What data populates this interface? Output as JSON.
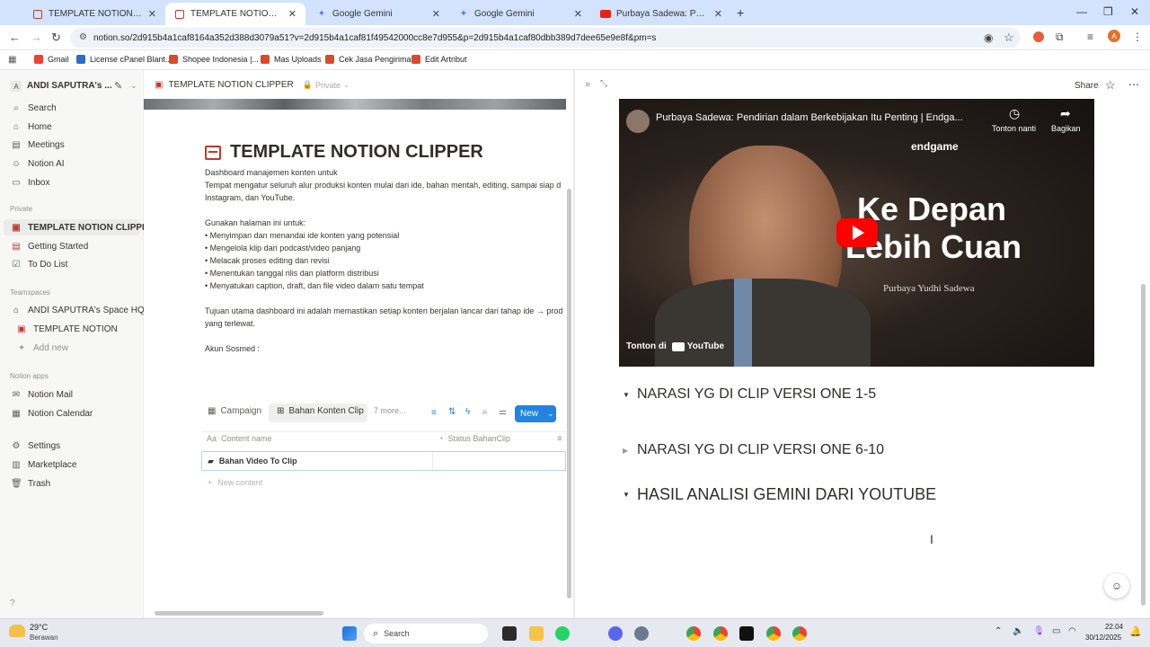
{
  "browser": {
    "tabs": [
      {
        "title": "TEMPLATE NOTION | Bahan Me",
        "icon": "notion-icon"
      },
      {
        "title": "TEMPLATE NOTION CLIPPER | B",
        "icon": "notion-icon"
      },
      {
        "title": "Google Gemini",
        "icon": "gemini-icon"
      },
      {
        "title": "Google Gemini",
        "icon": "gemini-icon"
      },
      {
        "title": "Purbaya Sadewa: Pendirian dal",
        "icon": "youtube-icon"
      }
    ],
    "url": "notion.so/2d915b4a1caf8164a352d388d3079a51?v=2d915b4a1caf81f49542000cc8e7d955&p=2d915b4a1caf80dbb389d7dee65e9e8f&pm=s",
    "bookmarks": [
      "Gmail",
      "License cPanel Blant...",
      "Shopee Indonesia |...",
      "Mas Uploads",
      "Cek Jasa Pengiriman",
      "Edit Artribut"
    ],
    "profile_initial": "A"
  },
  "sidebar": {
    "workspace": "ANDI SAPUTRA's ...",
    "workspace_initial": "A",
    "top_items": [
      "Search",
      "Home",
      "Meetings",
      "Notion AI",
      "Inbox"
    ],
    "private_header": "Private",
    "private_items": [
      "TEMPLATE NOTION CLIPPER",
      "Getting Started",
      "To Do List"
    ],
    "teamspaces_header": "Teamspaces",
    "teamspace_items": [
      "ANDI SAPUTRA's Space HQ",
      "TEMPLATE NOTION"
    ],
    "add_new": "Add new",
    "apps_header": "Notion apps",
    "app_items": [
      "Notion Mail",
      "Notion Calendar"
    ],
    "bottom_items": [
      "Settings",
      "Marketplace",
      "Trash"
    ]
  },
  "page": {
    "breadcrumb": "TEMPLATE NOTION CLIPPER",
    "privacy": "Private",
    "title": "TEMPLATE NOTION CLIPPER",
    "body_lines": [
      "Dashboard manajemen konten untuk",
      "Tempat mengatur seluruh alur produksi konten mulai dari ide, bahan mentah, editing, sampai siap d",
      "Instagram, dan YouTube.",
      "",
      "Gunakan halaman ini untuk:",
      "• Menyimpan dan menandai ide konten yang potensial",
      "• Mengelola klip dari podcast/video panjang",
      "• Melacak proses editing dan revisi",
      "• Menentukan tanggal rilis dan platform distribusi",
      "• Menyatukan caption, draft, dan file video dalam satu tempat",
      "",
      "Tujuan utama dashboard ini adalah memastikan setiap konten berjalan lancar dari tahap ide → prod",
      "yang terlewat.",
      "",
      "Akun Sosmed :"
    ],
    "db_tabs": [
      "Campaign",
      "Bahan Konten Clip",
      "7 more..."
    ],
    "new_button": "New",
    "columns": [
      "Content name",
      "Status BahanClip"
    ],
    "rows": [
      "Bahan Video To Clip"
    ],
    "new_content": "New content"
  },
  "right_panel": {
    "share": "Share",
    "video": {
      "title": "Purbaya Sadewa: Pendirian dalam Berkebijakan Itu Penting | Endga...",
      "watch_later": "Tonton nanti",
      "share": "Bagikan",
      "brand": "endgame",
      "headline_1": "Ke Depan",
      "headline_2": "Lebih Cuan",
      "guest": "Purbaya Yudhi Sadewa",
      "watch_on": "Tonton di",
      "youtube": "YouTube"
    },
    "toggles": [
      {
        "label": "NARASI YG DI CLIP VERSI ONE 1-5",
        "open": true
      },
      {
        "label": "NARASI YG DI CLIP VERSI ONE 6-10",
        "open": false
      },
      {
        "label": "HASIL ANALISI GEMINI DARI YOUTUBE",
        "open": true
      }
    ]
  },
  "taskbar": {
    "weather_temp": "29°C",
    "weather_desc": "Berawan",
    "search_placeholder": "Search",
    "time": "22.04",
    "date": "30/12/2025"
  }
}
